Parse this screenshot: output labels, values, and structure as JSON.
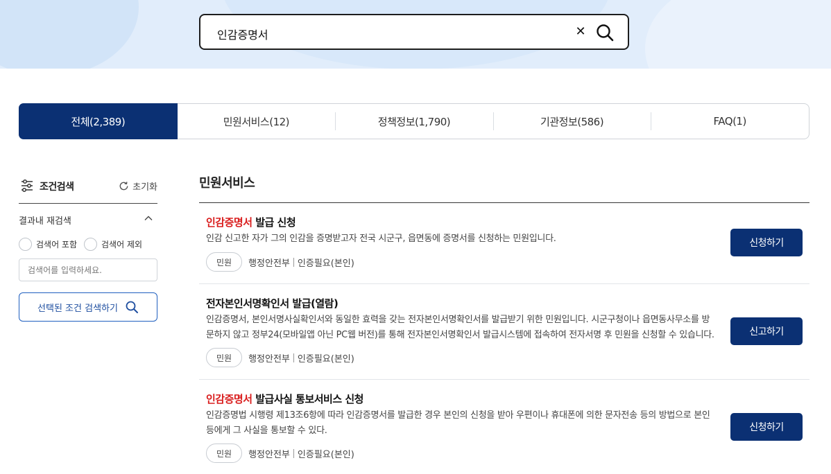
{
  "search": {
    "query": "인감증명서",
    "clear_glyph": "✕",
    "icon": "search-icon"
  },
  "tabs": [
    {
      "label": "전체(2,389)",
      "active": true
    },
    {
      "label": "민원서비스(12)",
      "active": false
    },
    {
      "label": "정책정보(1,790)",
      "active": false
    },
    {
      "label": "기관정보(586)",
      "active": false
    },
    {
      "label": "FAQ(1)",
      "active": false
    }
  ],
  "filter": {
    "title": "조건검색",
    "reset_label": "초기화",
    "refine_label": "결과내 재검색",
    "include_label": "검색어 포함",
    "exclude_label": "검색어 제외",
    "input_placeholder": "검색어를 입력하세요.",
    "apply_label": "선택된 조건 검색하기"
  },
  "results": {
    "section_title": "민원서비스",
    "items": [
      {
        "title_highlight": "인감증명서",
        "title_rest": " 발급 신청",
        "description": "인감 신고한 자가 그의 인감을 증명받고자 전국 시군구, 읍면동에 증명서를 신청하는 민원입니다.",
        "badge": "민원",
        "agency": "행정안전부",
        "auth": "인증필요(본인)",
        "button": "신청하기"
      },
      {
        "title_highlight": "",
        "title_rest": "전자본인서명확인서 발급(열람)",
        "description": "인감증명서, 본인서명사실확인서와 동일한 효력을 갖는 전자본인서명확인서를 발급받기 위한 민원입니다. 시군구청이나 읍면동사무소를 방문하지 않고 정부24(모바일앱 아닌 PC웹 버전)를 통해 전자본인서명확인서 발급시스템에 접속하여 전자서명 후 민원을 신청할 수 있습니다.",
        "badge": "민원",
        "agency": "행정안전부",
        "auth": "인증필요(본인)",
        "button": "신고하기"
      },
      {
        "title_highlight": "인감증명서",
        "title_rest": " 발급사실 통보서비스 신청",
        "description": "인감증명법 시행령 제13조6항에 따라 인감증명서를 발급한 경우 본인의 신청을 받아 우편이나 휴대폰에 의한 문자전송 등의 방법으로 본인 등에게 그 사실을 통보할 수 있다.",
        "badge": "민원",
        "agency": "행정안전부",
        "auth": "인증필요(본인)",
        "button": "신청하기"
      }
    ]
  },
  "colors": {
    "primary": "#0b3073",
    "highlight": "#d91c1c",
    "header_bg": "#e1edfb",
    "outline_blue": "#1f5fbf"
  }
}
